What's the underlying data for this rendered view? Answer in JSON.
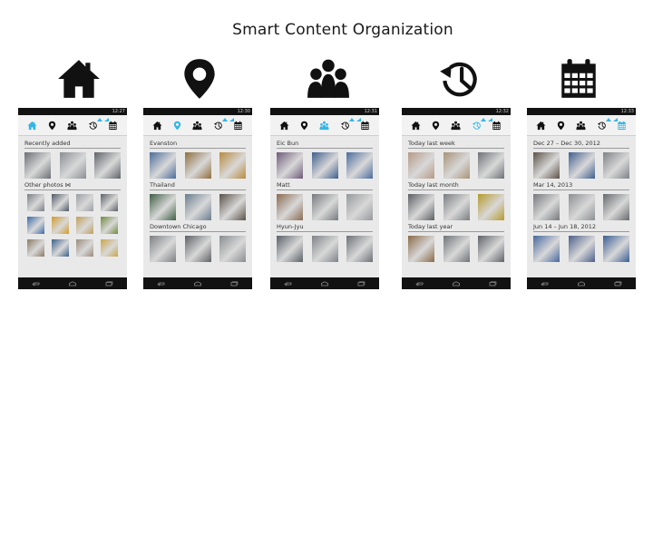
{
  "title": "Smart Content Organization",
  "colors": {
    "accent": "#33b5e5",
    "icon": "#111111",
    "statusbar": "#121212",
    "screen_bg": "#e9e9e9"
  },
  "top_icons": [
    "home-icon",
    "map-pin-icon",
    "people-icon",
    "history-icon",
    "calendar-icon"
  ],
  "phones": [
    {
      "name": "home",
      "active_tab": 0,
      "time": "12:27",
      "sections": [
        {
          "label": "Recently added",
          "size": "large",
          "thumbs": [
            "#6b6f74",
            "#8a8e93",
            "#5f6368"
          ]
        },
        {
          "label": "Other photos ⋈",
          "size": "small",
          "thumbs": [
            "#7a7f86",
            "#4f5a66",
            "#9a9ea3",
            "#5b6168"
          ]
        },
        {
          "label": "",
          "size": "small",
          "thumbs": [
            "#3d6aa8",
            "#d39a2a",
            "#c2a05a",
            "#6f8a3e"
          ]
        },
        {
          "label": "",
          "size": "small",
          "thumbs": [
            "#8c7a63",
            "#3b5f8a",
            "#9b8c7c",
            "#c9a646"
          ]
        }
      ]
    },
    {
      "name": "places",
      "active_tab": 1,
      "time": "12:30",
      "sections": [
        {
          "label": "Evanston",
          "size": "large",
          "thumbs": [
            "#4a6d9a",
            "#8f6f3c",
            "#b88a3e"
          ]
        },
        {
          "label": "Thailand",
          "size": "large",
          "thumbs": [
            "#3f5f45",
            "#6a7d8e",
            "#5a5148"
          ]
        },
        {
          "label": "Downtown Chicago",
          "size": "large",
          "thumbs": [
            "#7d7f82",
            "#5e6165",
            "#8a8d90"
          ]
        }
      ]
    },
    {
      "name": "people",
      "active_tab": 2,
      "time": "12:31",
      "sections": [
        {
          "label": "Eic Bun",
          "size": "large",
          "thumbs": [
            "#6e5a7a",
            "#3e5f8c",
            "#4a6c9e"
          ]
        },
        {
          "label": "Matt",
          "size": "large",
          "thumbs": [
            "#8a6a50",
            "#777a7d",
            "#96999c"
          ]
        },
        {
          "label": "Hyun-Jyu",
          "size": "large",
          "thumbs": [
            "#5a6068",
            "#7e8387",
            "#6c7176"
          ]
        }
      ]
    },
    {
      "name": "history",
      "active_tab": 3,
      "time": "12:32",
      "sections": [
        {
          "label": "Today last week",
          "size": "large",
          "thumbs": [
            "#b59a86",
            "#a89378",
            "#6e7175"
          ]
        },
        {
          "label": "Today last month",
          "size": "large",
          "thumbs": [
            "#5c5f63",
            "#7a7d80",
            "#b59a2e"
          ]
        },
        {
          "label": "Today last year",
          "size": "large",
          "thumbs": [
            "#8a6a46",
            "#6f7478",
            "#5f6268"
          ]
        }
      ]
    },
    {
      "name": "calendar",
      "active_tab": 4,
      "time": "12:33",
      "sections": [
        {
          "label": "Dec 27 – Dec 30, 2012",
          "size": "large",
          "thumbs": [
            "#5d5148",
            "#3f5f8f",
            "#7e8286"
          ]
        },
        {
          "label": "Mar 14, 2013",
          "size": "large",
          "thumbs": [
            "#75787c",
            "#8c8f92",
            "#66696d"
          ]
        },
        {
          "label": "Jun 14 – Jun 18, 2012",
          "size": "large",
          "thumbs": [
            "#46689e",
            "#4c5f8a",
            "#3a5d93"
          ]
        }
      ]
    }
  ]
}
